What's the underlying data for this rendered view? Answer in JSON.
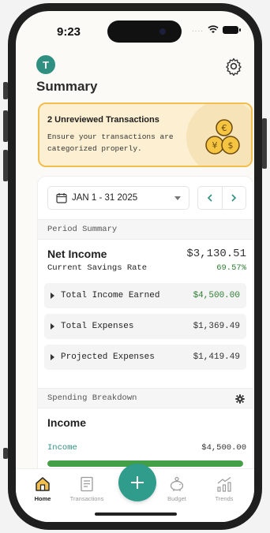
{
  "status_bar": {
    "time": "9:23",
    "signal": "....",
    "icons": [
      "wifi-icon",
      "battery-icon"
    ]
  },
  "header": {
    "avatar_initial": "T",
    "title": "Summary",
    "settings_icon": "gear-icon"
  },
  "alert": {
    "title": "2 Unreviewed Transactions",
    "body": "Ensure your transactions are categorized properly.",
    "icon": "coins-icon"
  },
  "period": {
    "date_range": "JAN 1 - 31 2025",
    "prev_icon": "chevron-left-icon",
    "next_icon": "chevron-right-icon"
  },
  "period_summary": {
    "heading": "Period Summary",
    "net_income_label": "Net Income",
    "net_income_value": "$3,130.51",
    "savings_rate_label": "Current Savings Rate",
    "savings_rate_value": "69.57%",
    "rows": [
      {
        "label": "Total Income Earned",
        "value": "$4,500.00"
      },
      {
        "label": "Total Expenses",
        "value": "$1,369.49"
      },
      {
        "label": "Projected Expenses",
        "value": "$1,419.49"
      }
    ]
  },
  "spending_breakdown": {
    "heading": "Spending Breakdown",
    "income_title": "Income",
    "income_label": "Income",
    "income_value": "$4,500.00",
    "income_progress_fraction": 1.0
  },
  "tabbar": {
    "items": [
      {
        "label": "Home",
        "icon": "home-icon",
        "active": true
      },
      {
        "label": "Transactions",
        "icon": "receipt-icon",
        "active": false
      },
      {
        "label": "Budget",
        "icon": "piggy-bank-icon",
        "active": false
      },
      {
        "label": "Trends",
        "icon": "trends-icon",
        "active": false
      }
    ],
    "fab_icon": "plus-icon"
  },
  "colors": {
    "accent": "#2f9c8c",
    "alert_bg": "#fdf0d2",
    "alert_border": "#f2be4c",
    "positive": "#2e7d32",
    "progress": "#43a047"
  }
}
